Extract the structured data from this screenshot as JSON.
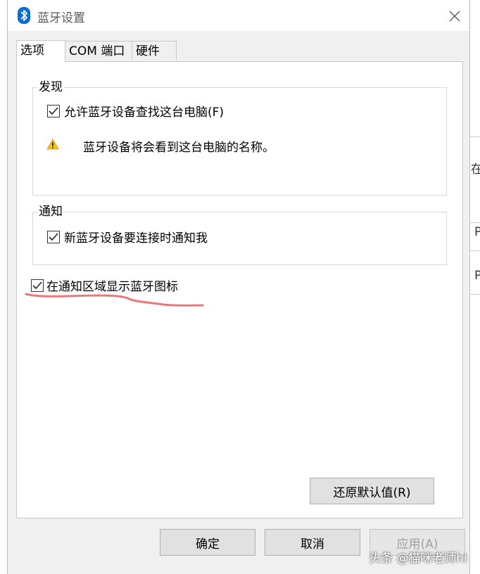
{
  "window": {
    "title": "蓝牙设置",
    "icon": "bluetooth-icon",
    "close_icon": "close-icon"
  },
  "tabs": [
    {
      "label": "选项",
      "active": true
    },
    {
      "label": "COM 端口",
      "active": false
    },
    {
      "label": "硬件",
      "active": false
    }
  ],
  "discovery": {
    "title": "发现",
    "allow_discovery": {
      "label": "允许蓝牙设备查找这台电脑(F)",
      "checked": true
    },
    "warning_icon": "warning-icon",
    "warning_text": "蓝牙设备将会看到这台电脑的名称。"
  },
  "notification": {
    "title": "通知",
    "notify_new": {
      "label": "新蓝牙设备要连接时通知我",
      "checked": true
    }
  },
  "show_icon": {
    "label": "在通知区域显示蓝牙图标",
    "checked": true
  },
  "annotation_color": "#e9787c",
  "buttons": {
    "restore": "还原默认值(R)",
    "ok": "确定",
    "cancel": "取消",
    "apply": "应用(A)"
  },
  "watermark": "头条 @猫咪老师hi",
  "background_window": {
    "edge_chars": [
      "在",
      "P",
      "P"
    ]
  }
}
